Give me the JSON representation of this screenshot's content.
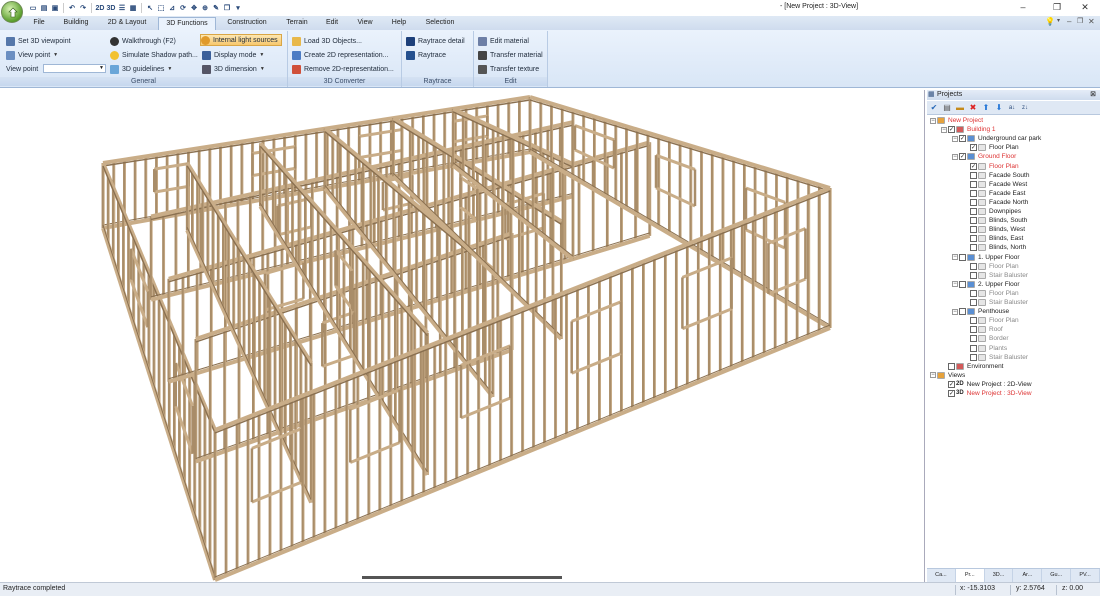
{
  "window": {
    "title": "- [New Project : 3D-View]",
    "minimize": "–",
    "maximize": "❐",
    "close": "✕"
  },
  "qat": [
    "2D",
    "3D"
  ],
  "tabs": [
    "File",
    "Building",
    "2D & Layout",
    "3D Functions",
    "Construction",
    "Terrain",
    "Edit",
    "View",
    "Help",
    "Selection"
  ],
  "ribbon": {
    "general": {
      "label": "General",
      "set_viewpoint": "Set 3D viewpoint",
      "view_point": "View point",
      "view_point_label": "View point",
      "walkthrough": "Walkthrough (F2)",
      "simulate_shadow": "Simulate Shadow path...",
      "guidelines": "3D guidelines",
      "internal_lights": "Internal light sources",
      "display_mode": "Display mode",
      "dimension": "3D dimension"
    },
    "converter": {
      "label": "3D Converter",
      "load_objects": "Load 3D Objects...",
      "create_2d": "Create 2D representation...",
      "remove_2d": "Remove 2D-representation..."
    },
    "raytrace": {
      "label": "Raytrace",
      "detail": "Raytrace detail",
      "raytrace": "Raytrace"
    },
    "edit": {
      "label": "Edit",
      "edit_material": "Edit material",
      "transfer_material": "Transfer material",
      "transfer_texture": "Transfer texture"
    }
  },
  "panel": {
    "title": "Projects",
    "tree": [
      {
        "label": "New Project",
        "level": 0,
        "exp": "⊟",
        "cb": false,
        "cls": "red"
      },
      {
        "label": "Building 1",
        "level": 1,
        "exp": "⊟",
        "cb": "✓",
        "cls": "red"
      },
      {
        "label": "Underground car park",
        "level": 2,
        "exp": "⊟",
        "cb": "✓",
        "cls": ""
      },
      {
        "label": "Floor Plan",
        "level": 3,
        "exp": "",
        "cb": "✓",
        "cls": ""
      },
      {
        "label": "Ground Floor",
        "level": 2,
        "exp": "⊟",
        "cb": "✓",
        "cls": "red"
      },
      {
        "label": "Floor Plan",
        "level": 3,
        "exp": "",
        "cb": "✓",
        "cls": "red"
      },
      {
        "label": "Facade South",
        "level": 3,
        "exp": "",
        "cb": "",
        "cls": ""
      },
      {
        "label": "Facade West",
        "level": 3,
        "exp": "",
        "cb": "",
        "cls": ""
      },
      {
        "label": "Facade East",
        "level": 3,
        "exp": "",
        "cb": "",
        "cls": ""
      },
      {
        "label": "Facade North",
        "level": 3,
        "exp": "",
        "cb": "",
        "cls": ""
      },
      {
        "label": "Downpipes",
        "level": 3,
        "exp": "",
        "cb": "",
        "cls": ""
      },
      {
        "label": "Blinds, South",
        "level": 3,
        "exp": "",
        "cb": "",
        "cls": ""
      },
      {
        "label": "Blinds, West",
        "level": 3,
        "exp": "",
        "cb": "",
        "cls": ""
      },
      {
        "label": "Blinds, East",
        "level": 3,
        "exp": "",
        "cb": "",
        "cls": ""
      },
      {
        "label": "Blinds, North",
        "level": 3,
        "exp": "",
        "cb": "",
        "cls": ""
      },
      {
        "label": "1. Upper Floor",
        "level": 2,
        "exp": "⊟",
        "cb": "",
        "cls": ""
      },
      {
        "label": "Floor Plan",
        "level": 3,
        "exp": "",
        "cb": "",
        "cls": "gray"
      },
      {
        "label": "Stair Baluster",
        "level": 3,
        "exp": "",
        "cb": "",
        "cls": "gray"
      },
      {
        "label": "2. Upper Floor",
        "level": 2,
        "exp": "⊟",
        "cb": "",
        "cls": ""
      },
      {
        "label": "Floor Plan",
        "level": 3,
        "exp": "",
        "cb": "",
        "cls": "gray"
      },
      {
        "label": "Stair Baluster",
        "level": 3,
        "exp": "",
        "cb": "",
        "cls": "gray"
      },
      {
        "label": "Penthouse",
        "level": 2,
        "exp": "⊟",
        "cb": "",
        "cls": ""
      },
      {
        "label": "Floor Plan",
        "level": 3,
        "exp": "",
        "cb": "",
        "cls": "gray"
      },
      {
        "label": "Roof",
        "level": 3,
        "exp": "",
        "cb": "",
        "cls": "gray"
      },
      {
        "label": "Border",
        "level": 3,
        "exp": "",
        "cb": "",
        "cls": "gray"
      },
      {
        "label": "Plants",
        "level": 3,
        "exp": "",
        "cb": "",
        "cls": "gray"
      },
      {
        "label": "Stair Baluster",
        "level": 3,
        "exp": "",
        "cb": "",
        "cls": "gray"
      },
      {
        "label": "Environment",
        "level": 1,
        "exp": "",
        "cb": "",
        "cls": ""
      },
      {
        "label": "Views",
        "level": 0,
        "exp": "⊟",
        "cb": false,
        "cls": ""
      },
      {
        "label": "New Project : 2D-View",
        "level": 1,
        "exp": "",
        "cb": "✓",
        "cls": "",
        "tag": "2D"
      },
      {
        "label": "New Project : 3D-View",
        "level": 1,
        "exp": "",
        "cb": "✓",
        "cls": "red",
        "tag": "3D"
      }
    ],
    "tabs": [
      "Ca...",
      "Pr...",
      "3D...",
      "Ar...",
      "Gu...",
      "PV..."
    ]
  },
  "status": {
    "message": "Raytrace completed",
    "x": "x: -15.3103",
    "y": "y: 2.5764",
    "z": "z: 0.00"
  },
  "colors": {
    "wood": "#c9ad88",
    "wood_dark": "#a98d69",
    "wood_edge": "#8a7050"
  }
}
